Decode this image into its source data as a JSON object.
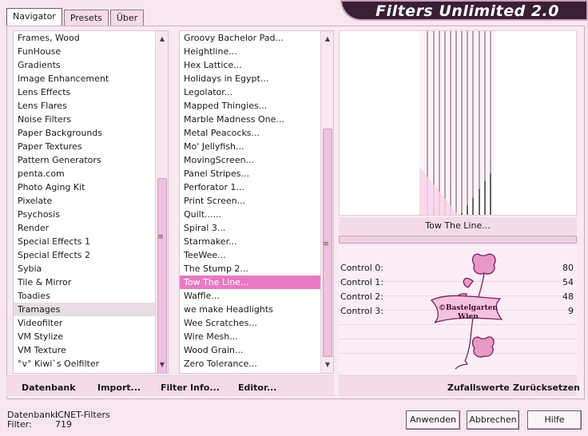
{
  "tabs": [
    "Navigator",
    "Presets",
    "Über"
  ],
  "title": "Filters Unlimited 2.0",
  "categories": [
    "Frames, Wood",
    "FunHouse",
    "Gradients",
    "Image Enhancement",
    "Lens Effects",
    "Lens Flares",
    "Noise Filters",
    "Paper Backgrounds",
    "Paper Textures",
    "Pattern Generators",
    "penta.com",
    "Photo Aging Kit",
    "Pixelate",
    "Psychosis",
    "Render",
    "Special Effects 1",
    "Special Effects 2",
    "Sybia",
    "Tile & Mirror",
    "Toadies",
    "Tramages",
    "Videofilter",
    "VM Stylize",
    "VM Texture",
    "°v° Kiwi`s Oelfilter"
  ],
  "selected_category": "Tramages",
  "filters": [
    "Groovy Bachelor Pad...",
    "Heightline...",
    "Hex Lattice...",
    "Holidays in Egypt...",
    "Legolator...",
    "Mapped Thingies...",
    "Marble Madness One...",
    "Metal Peacocks...",
    "Mo' Jellyfish...",
    "MovingScreen...",
    "Panel Stripes...",
    "Perforator 1...",
    "Print Screen...",
    "Quilt......",
    "Spiral 3...",
    "Starmaker...",
    "TeeWee...",
    "The Stump 2...",
    "Tow The Line...",
    "Waffle...",
    "we make Headlights",
    "Wee Scratches...",
    "Wire Mesh...",
    "Wood Grain...",
    "Zero Tolerance..."
  ],
  "selected_filter": "Tow The Line...",
  "filter_name": "Tow The Line...",
  "controls": [
    {
      "label": "Control 0:",
      "value": "80"
    },
    {
      "label": "Control 1:",
      "value": "54"
    },
    {
      "label": "Control 2:",
      "value": "48"
    },
    {
      "label": "Control 3:",
      "value": "9"
    }
  ],
  "toolbar": {
    "datenbank": "Datenbank",
    "import": "Import...",
    "filter_info": "Filter Info...",
    "editor": "Editor...",
    "zufallswerte": "Zufallswerte",
    "zuruecksetzen": "Zurücksetzen"
  },
  "status": {
    "datenbank_label": "Datenbank:",
    "datenbank_value": "ICNET-Filters",
    "filter_label": "Filter:",
    "filter_value": "719"
  },
  "buttons": {
    "apply": "Anwenden",
    "cancel": "Abbrechen",
    "help": "Hilfe"
  },
  "watermark": {
    "line1": "©Bastelgarten",
    "line2": "Wien"
  }
}
